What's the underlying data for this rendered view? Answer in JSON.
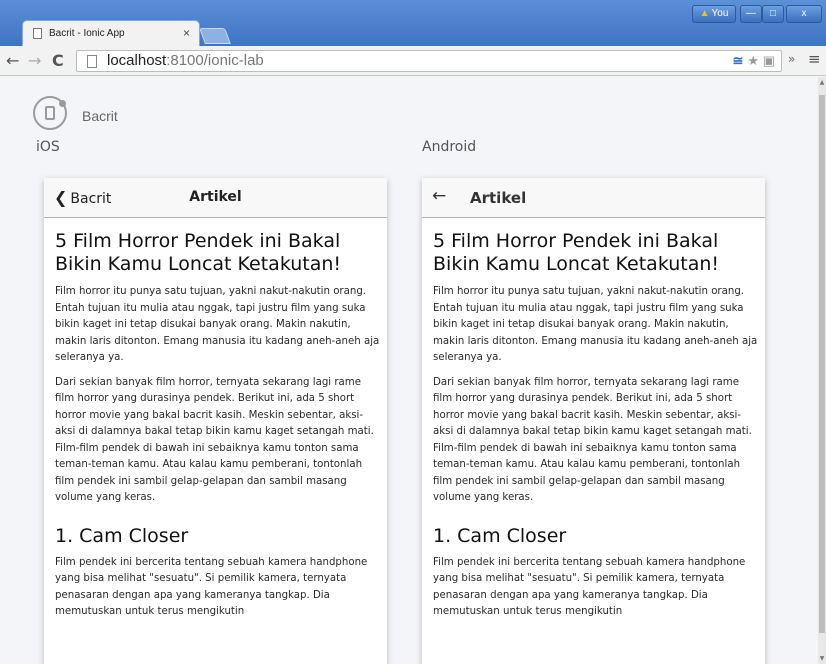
{
  "browser": {
    "tab_title": "Bacrit - Ionic App",
    "tab_close": "×",
    "profile_label": "You",
    "url_host": "localhost",
    "url_path": ":8100/ionic-lab",
    "controls": {
      "minimize": "—",
      "maximize": "□",
      "close": "x"
    },
    "nav": {
      "back": "←",
      "forward": "→",
      "reload": "C"
    },
    "extensions": "»",
    "menu": "≡"
  },
  "lab": {
    "app_name": "Bacrit",
    "platforms": [
      "iOS",
      "Android"
    ]
  },
  "ios": {
    "back_label": "Bacrit",
    "title": "Artikel"
  },
  "android": {
    "back_arrow": "←",
    "title": "Artikel"
  },
  "article": {
    "heading": "5 Film Horror Pendek ini Bakal Bikin Kamu Loncat Ketakutan!",
    "paragraphs": [
      "Film horror itu punya satu tujuan, yakni nakut-nakutin orang. Entah tujuan itu mulia atau nggak, tapi justru film yang suka bikin kaget ini tetap disukai banyak orang. Makin nakutin, makin laris ditonton. Emang manusia itu kadang aneh-aneh aja seleranya ya.",
      "Dari sekian banyak film horror, ternyata sekarang lagi rame film horror yang durasinya pendek. Berikut ini, ada 5 short horror movie yang bakal bacrit kasih. Meskin sebentar, aksi-aksi di dalamnya bakal tetap bikin kamu kaget setangah mati. Film-film pendek di bawah ini sebaiknya kamu tonton sama teman-teman kamu. Atau kalau kamu pemberani, tontonlah film pendek ini sambil gelap-gelapan dan sambil masang volume yang keras."
    ],
    "section_title": "1. Cam Closer",
    "section_paragraph": "Film pendek ini bercerita tentang sebuah kamera handphone yang bisa melihat \"sesuatu\". Si pemilik kamera, ternyata penasaran dengan apa yang kameranya tangkap. Dia memutuskan untuk terus mengikutin"
  }
}
